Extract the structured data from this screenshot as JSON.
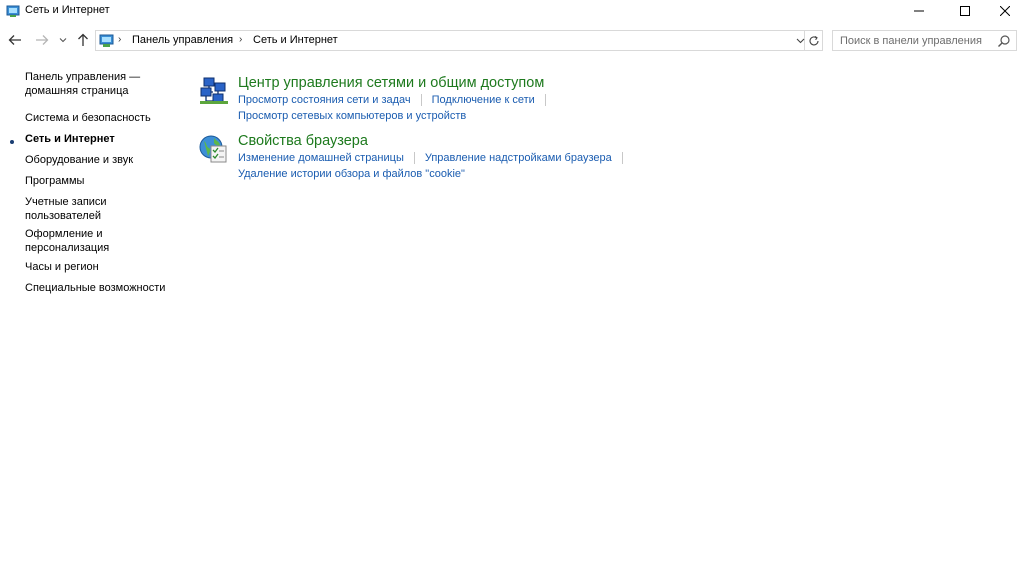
{
  "window": {
    "title": "Сеть и Интернет"
  },
  "navigation": {
    "breadcrumbs": [
      {
        "label": "Панель управления"
      },
      {
        "label": "Сеть и Интернет"
      }
    ],
    "search_placeholder": "Поиск в панели управления"
  },
  "sidebar": {
    "items": [
      {
        "label": "Панель управления — домашняя страница",
        "active": false
      },
      {
        "label": "Система и безопасность",
        "active": false
      },
      {
        "label": "Сеть и Интернет",
        "active": true
      },
      {
        "label": "Оборудование и звук",
        "active": false
      },
      {
        "label": "Программы",
        "active": false
      },
      {
        "label": "Учетные записи пользователей",
        "active": false
      },
      {
        "label": "Оформление и персонализация",
        "active": false
      },
      {
        "label": "Часы и регион",
        "active": false
      },
      {
        "label": "Специальные возможности",
        "active": false
      }
    ]
  },
  "categories": [
    {
      "title": "Центр управления сетями и общим доступом",
      "icon": "network-center-icon",
      "tasks": [
        [
          "Просмотр состояния сети и задач",
          "Подключение к сети"
        ],
        [
          "Просмотр сетевых компьютеров и устройств"
        ]
      ]
    },
    {
      "title": "Свойства браузера",
      "icon": "browser-properties-icon",
      "tasks": [
        [
          "Изменение домашней страницы",
          "Управление надстройками браузера"
        ],
        [
          "Удаление истории обзора и файлов \"cookie\""
        ]
      ]
    }
  ],
  "colors": {
    "category_title": "#1e7a1e",
    "link": "#1a5cb0"
  }
}
